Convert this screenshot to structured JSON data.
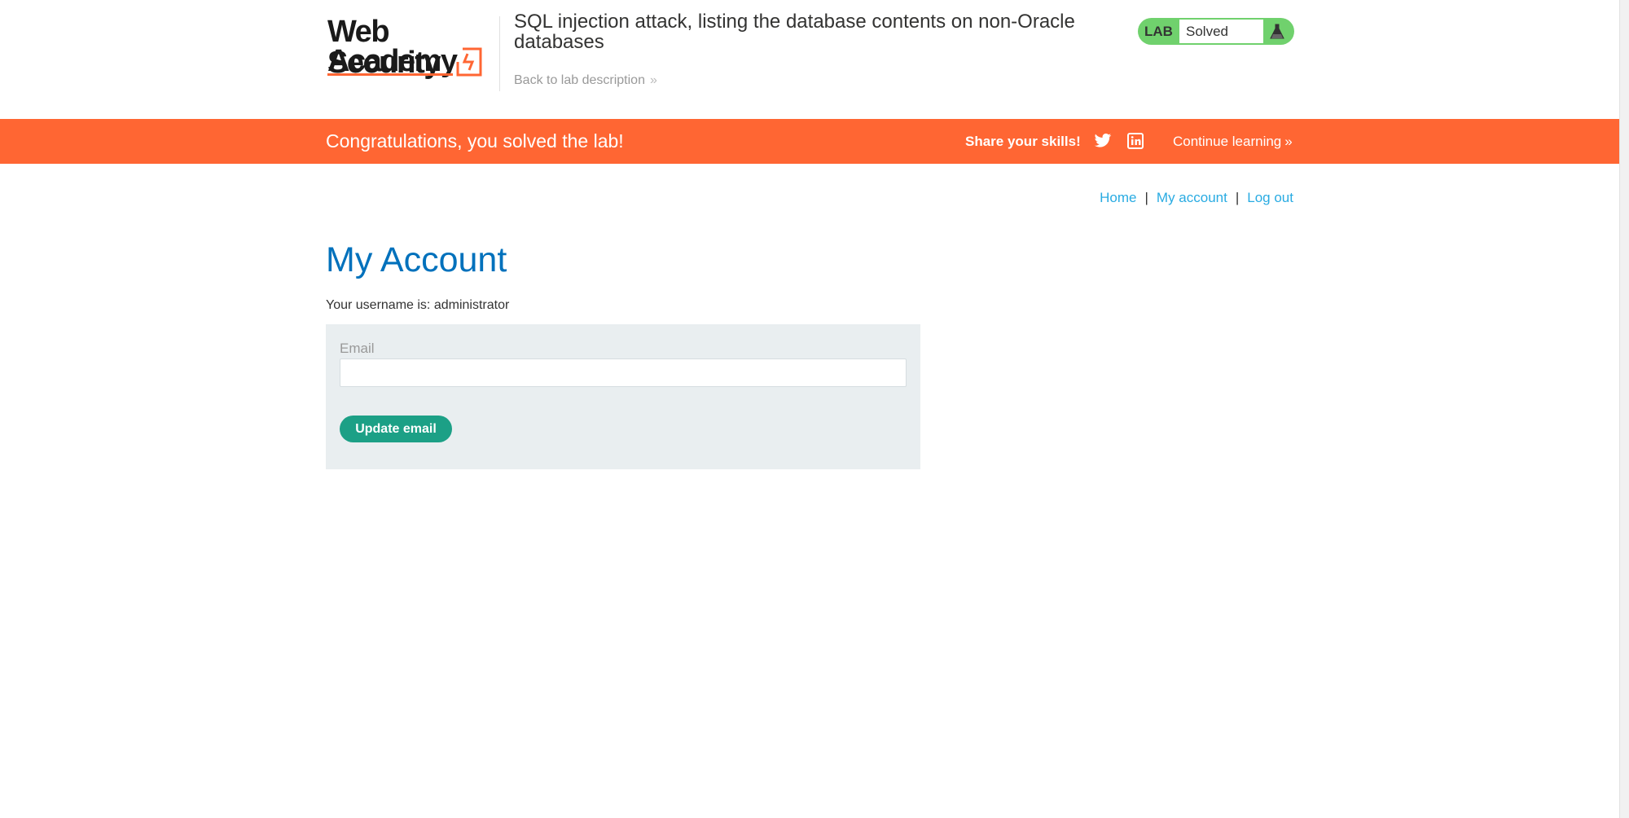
{
  "header": {
    "logo": {
      "line1": "Web Security",
      "line2": "Academy"
    },
    "lab_title": "SQL injection attack, listing the database contents on non-Oracle databases",
    "back_link": "Back to lab description",
    "back_chevron": "»",
    "lab_status": {
      "tag": "LAB",
      "status": "Solved",
      "icon": "flask-icon"
    }
  },
  "banner": {
    "message": "Congratulations, you solved the lab!",
    "share_label": "Share your skills!",
    "icons": [
      "twitter-icon",
      "linkedin-icon"
    ],
    "continue_label": "Continue learning",
    "continue_chevron": "»",
    "color": "#ff6633"
  },
  "nav": {
    "home": "Home",
    "my_account": "My account",
    "log_out": "Log out",
    "separator": "|"
  },
  "main": {
    "title": "My Account",
    "username_text": "Your username is: administrator",
    "form": {
      "email_label": "Email",
      "email_value": "",
      "submit_label": "Update email"
    }
  },
  "colors": {
    "accent_orange": "#ff6633",
    "title_blue": "#0071bc",
    "link_blue": "#29abe2",
    "button_green": "#1ca086",
    "status_green": "#70d16d"
  }
}
